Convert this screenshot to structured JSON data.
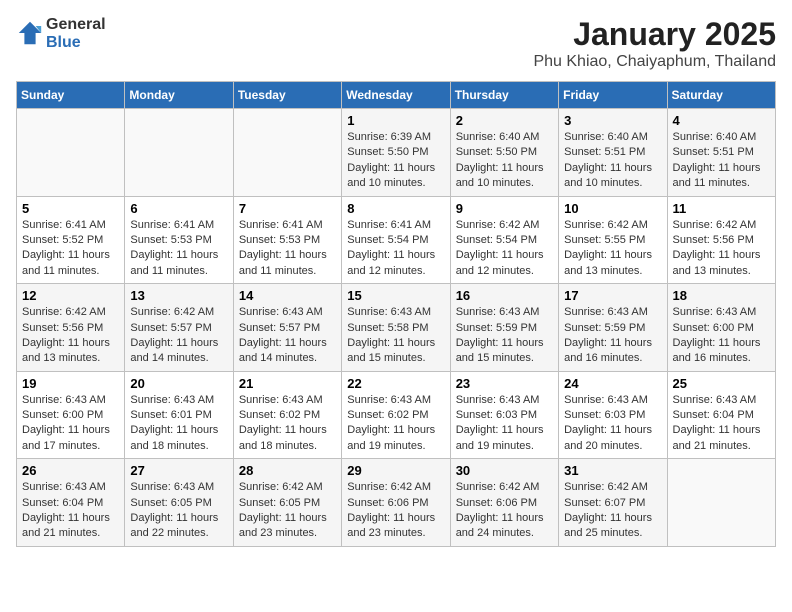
{
  "header": {
    "logo_general": "General",
    "logo_blue": "Blue",
    "title": "January 2025",
    "subtitle": "Phu Khiao, Chaiyaphum, Thailand"
  },
  "calendar": {
    "days_of_week": [
      "Sunday",
      "Monday",
      "Tuesday",
      "Wednesday",
      "Thursday",
      "Friday",
      "Saturday"
    ],
    "weeks": [
      [
        {
          "day": "",
          "info": ""
        },
        {
          "day": "",
          "info": ""
        },
        {
          "day": "",
          "info": ""
        },
        {
          "day": "1",
          "info": "Sunrise: 6:39 AM\nSunset: 5:50 PM\nDaylight: 11 hours and 10 minutes."
        },
        {
          "day": "2",
          "info": "Sunrise: 6:40 AM\nSunset: 5:50 PM\nDaylight: 11 hours and 10 minutes."
        },
        {
          "day": "3",
          "info": "Sunrise: 6:40 AM\nSunset: 5:51 PM\nDaylight: 11 hours and 10 minutes."
        },
        {
          "day": "4",
          "info": "Sunrise: 6:40 AM\nSunset: 5:51 PM\nDaylight: 11 hours and 11 minutes."
        }
      ],
      [
        {
          "day": "5",
          "info": "Sunrise: 6:41 AM\nSunset: 5:52 PM\nDaylight: 11 hours and 11 minutes."
        },
        {
          "day": "6",
          "info": "Sunrise: 6:41 AM\nSunset: 5:53 PM\nDaylight: 11 hours and 11 minutes."
        },
        {
          "day": "7",
          "info": "Sunrise: 6:41 AM\nSunset: 5:53 PM\nDaylight: 11 hours and 11 minutes."
        },
        {
          "day": "8",
          "info": "Sunrise: 6:41 AM\nSunset: 5:54 PM\nDaylight: 11 hours and 12 minutes."
        },
        {
          "day": "9",
          "info": "Sunrise: 6:42 AM\nSunset: 5:54 PM\nDaylight: 11 hours and 12 minutes."
        },
        {
          "day": "10",
          "info": "Sunrise: 6:42 AM\nSunset: 5:55 PM\nDaylight: 11 hours and 13 minutes."
        },
        {
          "day": "11",
          "info": "Sunrise: 6:42 AM\nSunset: 5:56 PM\nDaylight: 11 hours and 13 minutes."
        }
      ],
      [
        {
          "day": "12",
          "info": "Sunrise: 6:42 AM\nSunset: 5:56 PM\nDaylight: 11 hours and 13 minutes."
        },
        {
          "day": "13",
          "info": "Sunrise: 6:42 AM\nSunset: 5:57 PM\nDaylight: 11 hours and 14 minutes."
        },
        {
          "day": "14",
          "info": "Sunrise: 6:43 AM\nSunset: 5:57 PM\nDaylight: 11 hours and 14 minutes."
        },
        {
          "day": "15",
          "info": "Sunrise: 6:43 AM\nSunset: 5:58 PM\nDaylight: 11 hours and 15 minutes."
        },
        {
          "day": "16",
          "info": "Sunrise: 6:43 AM\nSunset: 5:59 PM\nDaylight: 11 hours and 15 minutes."
        },
        {
          "day": "17",
          "info": "Sunrise: 6:43 AM\nSunset: 5:59 PM\nDaylight: 11 hours and 16 minutes."
        },
        {
          "day": "18",
          "info": "Sunrise: 6:43 AM\nSunset: 6:00 PM\nDaylight: 11 hours and 16 minutes."
        }
      ],
      [
        {
          "day": "19",
          "info": "Sunrise: 6:43 AM\nSunset: 6:00 PM\nDaylight: 11 hours and 17 minutes."
        },
        {
          "day": "20",
          "info": "Sunrise: 6:43 AM\nSunset: 6:01 PM\nDaylight: 11 hours and 18 minutes."
        },
        {
          "day": "21",
          "info": "Sunrise: 6:43 AM\nSunset: 6:02 PM\nDaylight: 11 hours and 18 minutes."
        },
        {
          "day": "22",
          "info": "Sunrise: 6:43 AM\nSunset: 6:02 PM\nDaylight: 11 hours and 19 minutes."
        },
        {
          "day": "23",
          "info": "Sunrise: 6:43 AM\nSunset: 6:03 PM\nDaylight: 11 hours and 19 minutes."
        },
        {
          "day": "24",
          "info": "Sunrise: 6:43 AM\nSunset: 6:03 PM\nDaylight: 11 hours and 20 minutes."
        },
        {
          "day": "25",
          "info": "Sunrise: 6:43 AM\nSunset: 6:04 PM\nDaylight: 11 hours and 21 minutes."
        }
      ],
      [
        {
          "day": "26",
          "info": "Sunrise: 6:43 AM\nSunset: 6:04 PM\nDaylight: 11 hours and 21 minutes."
        },
        {
          "day": "27",
          "info": "Sunrise: 6:43 AM\nSunset: 6:05 PM\nDaylight: 11 hours and 22 minutes."
        },
        {
          "day": "28",
          "info": "Sunrise: 6:42 AM\nSunset: 6:05 PM\nDaylight: 11 hours and 23 minutes."
        },
        {
          "day": "29",
          "info": "Sunrise: 6:42 AM\nSunset: 6:06 PM\nDaylight: 11 hours and 23 minutes."
        },
        {
          "day": "30",
          "info": "Sunrise: 6:42 AM\nSunset: 6:06 PM\nDaylight: 11 hours and 24 minutes."
        },
        {
          "day": "31",
          "info": "Sunrise: 6:42 AM\nSunset: 6:07 PM\nDaylight: 11 hours and 25 minutes."
        },
        {
          "day": "",
          "info": ""
        }
      ]
    ]
  }
}
